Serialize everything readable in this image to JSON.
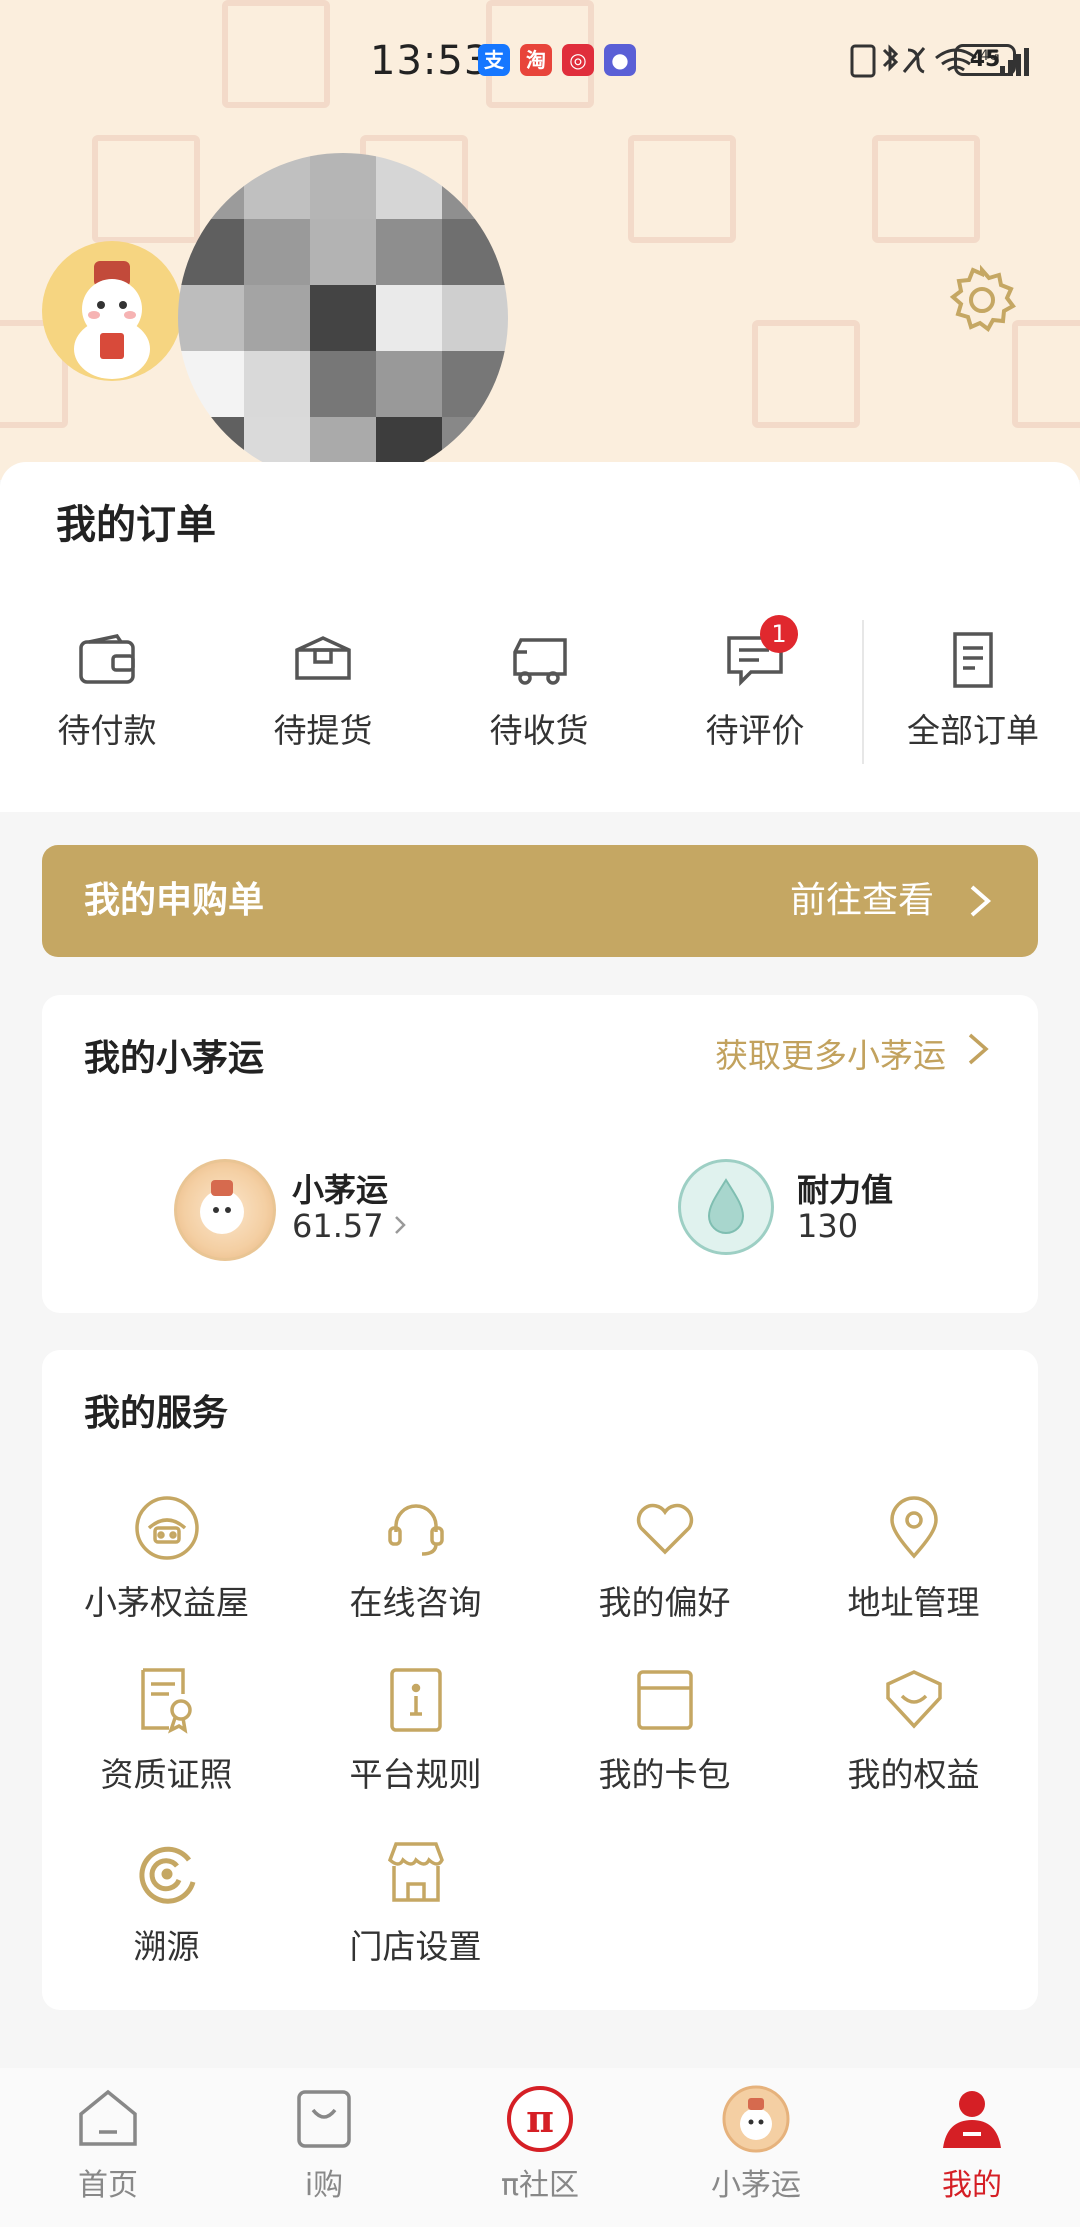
{
  "status_bar": {
    "time": "13:53",
    "battery": "45",
    "network": "4G"
  },
  "orders": {
    "title": "我的订单",
    "items": [
      {
        "label": "待付款",
        "icon": "wallet-icon"
      },
      {
        "label": "待提货",
        "icon": "box-icon"
      },
      {
        "label": "待收货",
        "icon": "truck-icon"
      },
      {
        "label": "待评价",
        "icon": "comment-icon",
        "badge": "1"
      },
      {
        "label": "全部订单",
        "icon": "document-list-icon"
      }
    ]
  },
  "subscription": {
    "title": "我的申购单",
    "link": "前往查看"
  },
  "luck": {
    "title": "我的小茅运",
    "more": "获取更多小茅运",
    "items": [
      {
        "name": "小茅运",
        "value": "61.57"
      },
      {
        "name": "耐力值",
        "value": "130"
      }
    ]
  },
  "services": {
    "title": "我的服务",
    "items": [
      {
        "label": "小茅权益屋",
        "icon": "benefits-house-icon"
      },
      {
        "label": "在线咨询",
        "icon": "headset-icon"
      },
      {
        "label": "我的偏好",
        "icon": "heart-icon"
      },
      {
        "label": "地址管理",
        "icon": "location-pin-icon"
      },
      {
        "label": "资质证照",
        "icon": "certificate-icon"
      },
      {
        "label": "平台规则",
        "icon": "rules-book-icon"
      },
      {
        "label": "我的卡包",
        "icon": "card-wallet-icon"
      },
      {
        "label": "我的权益",
        "icon": "rights-shield-icon"
      },
      {
        "label": "溯源",
        "icon": "traceability-icon"
      },
      {
        "label": "门店设置",
        "icon": "store-icon"
      }
    ]
  },
  "tabbar": {
    "active": "我的",
    "items": [
      {
        "label": "首页",
        "icon": "home-icon"
      },
      {
        "label": "i购",
        "icon": "shopping-bag-icon"
      },
      {
        "label": "π社区",
        "icon": "pi-community-icon"
      },
      {
        "label": "小茅运",
        "icon": "luck-mascot-icon"
      },
      {
        "label": "我的",
        "icon": "profile-icon"
      }
    ]
  },
  "colors": {
    "gold": "#c5a763",
    "accent_red": "#d51f25",
    "header_bg": "#fbeedd",
    "page_bg": "#f6f6f6"
  }
}
